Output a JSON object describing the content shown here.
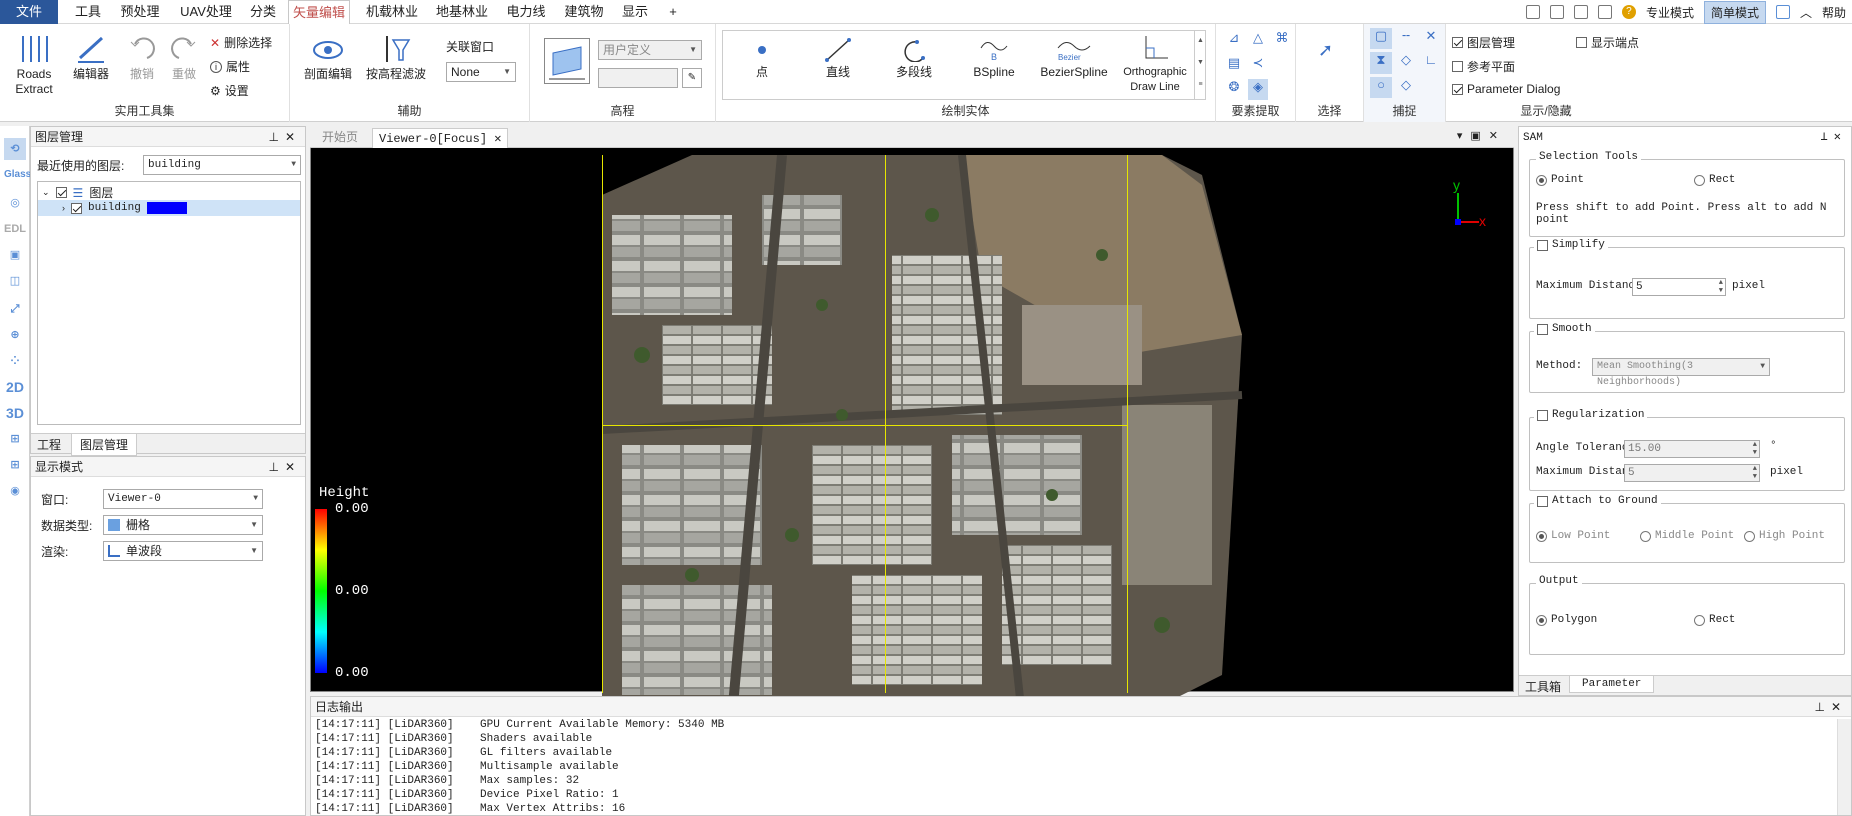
{
  "menubar": {
    "items": [
      "文件",
      "工具",
      "预处理",
      "UAV处理",
      "分类",
      "矢量编辑",
      "机载林业",
      "地基林业",
      "电力线",
      "建筑物",
      "显示",
      "+"
    ],
    "active": "矢量编辑",
    "right": {
      "pro_mode": "专业模式",
      "simple_mode": "简单模式",
      "help": "帮助"
    }
  },
  "ribbon": {
    "roads_extract": "Roads Extract",
    "editor": "编辑器",
    "undo": "撤销",
    "redo": "重做",
    "delete_select": "删除选择",
    "properties": "属性",
    "settings": "设置",
    "group_util": "实用工具集",
    "profile_edit": "剖面编辑",
    "elev_filter": "按高程滤波",
    "linked_window_label": "关联窗口",
    "linked_window_value": "None",
    "group_assist": "辅助",
    "elev_mode": "用户定义",
    "group_elev": "高程",
    "draw_items": [
      "点",
      "直线",
      "多段线",
      "BSpline",
      "BezierSpline",
      "Orthographic Draw Line"
    ],
    "group_draw": "绘制实体",
    "group_extract": "要素提取",
    "group_select": "选择",
    "group_snap": "捕捉",
    "show_layer_mgmt": "图层管理",
    "show_ref_plane": "参考平面",
    "show_param_dialog": "Parameter Dialog",
    "show_endpoints": "显示端点",
    "group_show": "显示/隐藏"
  },
  "layer_panel": {
    "title": "图层管理",
    "recent_label": "最近使用的图层:",
    "recent_value": "building",
    "root": "图层",
    "child": "building",
    "tabs": [
      "工程",
      "图层管理"
    ]
  },
  "display_panel": {
    "title": "显示模式",
    "window_label": "窗口:",
    "window_value": "Viewer-0",
    "datatype_label": "数据类型:",
    "datatype_value": "栅格",
    "render_label": "渲染:",
    "render_value": "单波段"
  },
  "viewer": {
    "tab_start": "开始页",
    "tab_viewer": "Viewer-0[Focus]",
    "legend_title": "Height",
    "legend_values": [
      "0.00",
      "0.00",
      "0.00"
    ],
    "axis_y": "y",
    "axis_x": "x"
  },
  "sam": {
    "title": "SAM",
    "selection_tools": "Selection Tools",
    "point": "Point",
    "rect": "Rect",
    "hint": "Press shift to add Point. Press alt to add N point",
    "simplify": "Simplify",
    "max_distance": "Maximum Distance",
    "simplify_value": "5",
    "pixel": "pixel",
    "smooth": "Smooth",
    "method_label": "Method:",
    "method_value": "Mean Smoothing(3 Neighborhoods)",
    "regularization": "Regularization",
    "angle_tol": "Angle Tolerance",
    "angle_value": "15.00",
    "degree": "°",
    "reg_dist_value": "5",
    "attach": "Attach to Ground",
    "low": "Low Point",
    "middle": "Middle Point",
    "high": "High Point",
    "output": "Output",
    "polygon": "Polygon",
    "out_rect": "Rect",
    "tabs": [
      "工具箱",
      "Parameter"
    ]
  },
  "log": {
    "title": "日志输出",
    "lines": [
      "[14:17:11] [LiDAR360]    GPU Current Available Memory: 5340 MB",
      "[14:17:11] [LiDAR360]    Shaders available",
      "[14:17:11] [LiDAR360]    GL filters available",
      "[14:17:11] [LiDAR360]    Multisample available",
      "[14:17:11] [LiDAR360]    Max samples: 32",
      "[14:17:11] [LiDAR360]    Device Pixel Ratio: 1",
      "[14:17:11] [LiDAR360]    Max Vertex Attribs: 16"
    ]
  },
  "left_strip": {
    "glass": "Glass",
    "edl": "EDL",
    "mode2d": "2D",
    "mode3d": "3D"
  },
  "colors": {
    "accent": "#2b579a",
    "active_tab": "#c0504d",
    "grid": "#e6e600",
    "selection": "#0000ff"
  }
}
